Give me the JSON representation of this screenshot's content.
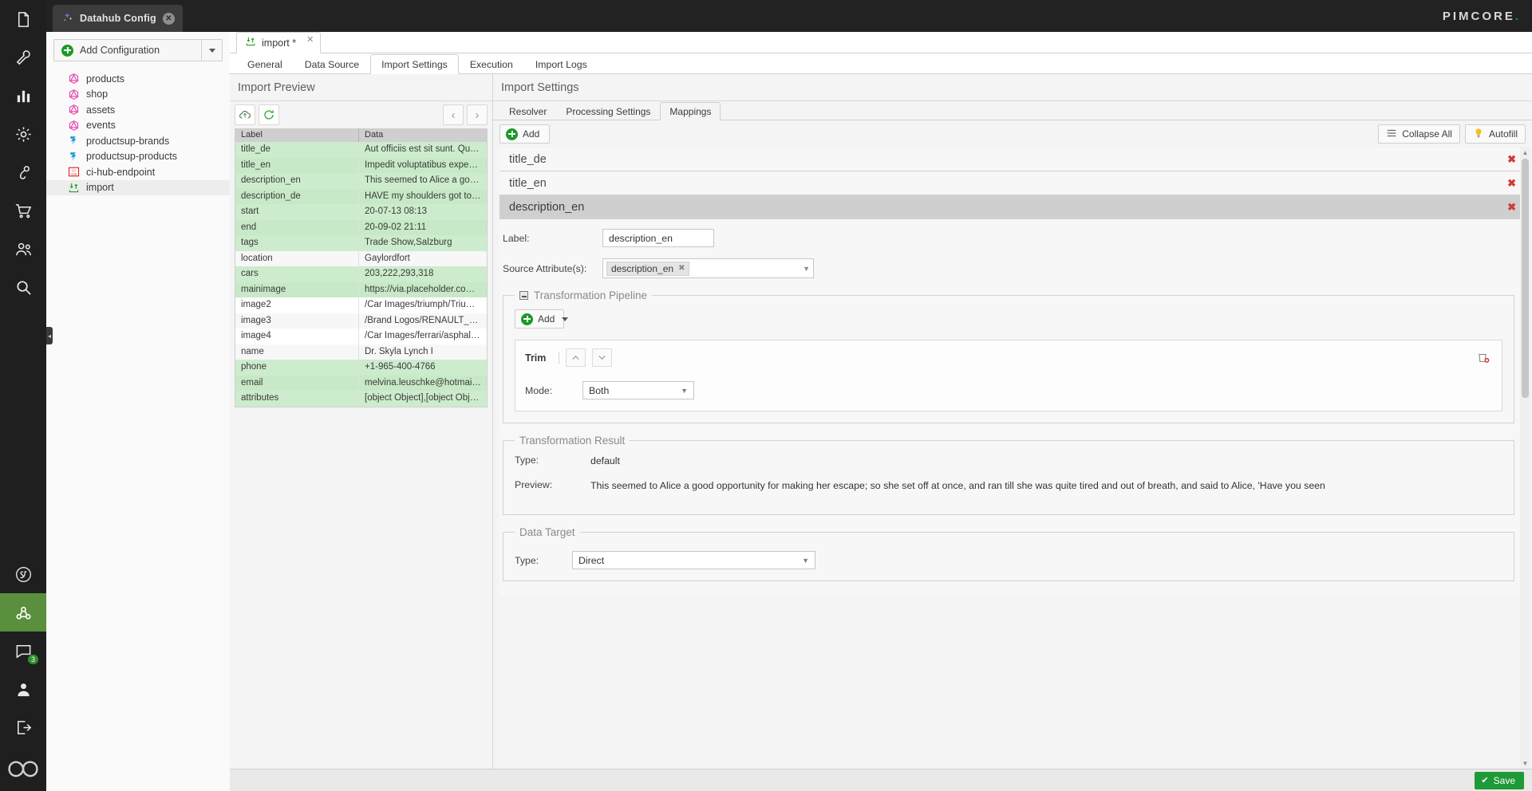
{
  "rail": {
    "items": [
      {
        "name": "documents-icon",
        "label": "Documents"
      },
      {
        "name": "tools-icon",
        "label": "Tools"
      },
      {
        "name": "reports-icon",
        "label": "Reports"
      },
      {
        "name": "settings-gear-icon",
        "label": "Settings"
      },
      {
        "name": "marketing-icon",
        "label": "Marketing"
      },
      {
        "name": "ecommerce-cart-icon",
        "label": "E-Commerce"
      },
      {
        "name": "customers-icon",
        "label": "Customers"
      },
      {
        "name": "search-icon",
        "label": "Search"
      }
    ],
    "lower_items": [
      {
        "name": "symfony-icon",
        "label": "Symfony"
      },
      {
        "name": "datahub-icon",
        "label": "Datahub",
        "active": true
      },
      {
        "name": "comments-icon",
        "label": "Comments",
        "badge": "3"
      },
      {
        "name": "user-account-icon",
        "label": "Account"
      },
      {
        "name": "logout-icon",
        "label": "Logout"
      },
      {
        "name": "pimcore-loop-logo",
        "label": "Pimcore"
      }
    ]
  },
  "sidepanel": {
    "tab_title": "Datahub Config",
    "tab_close": "✕",
    "add_configuration_label": "Add Configuration",
    "tree": [
      {
        "label": "products",
        "icon": "graphql-icon"
      },
      {
        "label": "shop",
        "icon": "graphql-icon"
      },
      {
        "label": "assets",
        "icon": "graphql-icon"
      },
      {
        "label": "events",
        "icon": "graphql-icon"
      },
      {
        "label": "productsup-brands",
        "icon": "productsup-icon"
      },
      {
        "label": "productsup-products",
        "icon": "productsup-icon"
      },
      {
        "label": "ci-hub-endpoint",
        "icon": "cihub-icon"
      },
      {
        "label": "import",
        "icon": "import-icon",
        "selected": true
      }
    ]
  },
  "brand": {
    "name_left": "PIMCORE",
    "name_dot": "."
  },
  "document_tab": {
    "label": "import *",
    "close": "✕",
    "icon": "import-icon"
  },
  "sub_tabs": [
    {
      "label": "General",
      "active": false
    },
    {
      "label": "Data Source",
      "active": false
    },
    {
      "label": "Import Settings",
      "active": true
    },
    {
      "label": "Execution",
      "active": false
    },
    {
      "label": "Import Logs",
      "active": false
    }
  ],
  "import_preview": {
    "title": "Import Preview",
    "upload_icon": "cloud-upload-icon",
    "refresh_icon": "refresh-icon",
    "prev_label": "‹",
    "next_label": "›",
    "columns": [
      "Label",
      "Data"
    ],
    "rows": [
      {
        "label": "title_de",
        "data": "Aut officiis est sit sunt. Qui do...",
        "highlight": true
      },
      {
        "label": "title_en",
        "data": "Impedit voluptatibus expedita...",
        "highlight": true
      },
      {
        "label": "description_en",
        "data": "This seemed to Alice a good o...",
        "highlight": true
      },
      {
        "label": "description_de",
        "data": "HAVE my shoulders got to? An...",
        "highlight": true
      },
      {
        "label": "start",
        "data": "20-07-13 08:13",
        "highlight": true
      },
      {
        "label": "end",
        "data": "20-09-02 21:11",
        "highlight": true
      },
      {
        "label": "tags",
        "data": "Trade Show,Salzburg",
        "highlight": true
      },
      {
        "label": "location",
        "data": "Gaylordfort",
        "highlight": false
      },
      {
        "label": "cars",
        "data": "203,222,293,318",
        "highlight": true
      },
      {
        "label": "mainimage",
        "data": "https://via.placeholder.com/4...",
        "highlight": true
      },
      {
        "label": "image2",
        "data": "/Car Images/triumph/Triump...",
        "highlight": false
      },
      {
        "label": "image3",
        "data": "/Brand Logos/RENAULT_LOG...",
        "highlight": false
      },
      {
        "label": "image4",
        "data": "/Car Images/ferrari/asphalt-a...",
        "highlight": false
      },
      {
        "label": "name",
        "data": "Dr. Skyla Lynch I",
        "highlight": false
      },
      {
        "label": "phone",
        "data": "+1-965-400-4766",
        "highlight": true
      },
      {
        "label": "email",
        "data": "melvina.leuschke@hotmail.com",
        "highlight": true
      },
      {
        "label": "attributes",
        "data": "[object Object],[object Object]",
        "highlight": true
      }
    ]
  },
  "import_settings": {
    "title": "Import Settings",
    "tabs": [
      {
        "label": "Resolver",
        "active": false
      },
      {
        "label": "Processing Settings",
        "active": false
      },
      {
        "label": "Mappings",
        "active": true
      }
    ],
    "toolbar": {
      "add_label": "Add",
      "collapse_all_label": "Collapse All",
      "collapse_icon": "list-lines-icon",
      "autofill_label": "Autofill",
      "autofill_icon": "lightbulb-icon"
    },
    "mappings": [
      {
        "name": "title_de",
        "open": false,
        "remove": "✖"
      },
      {
        "name": "title_en",
        "open": false,
        "remove": "✖"
      },
      {
        "name": "description_en",
        "open": true,
        "remove": "✖"
      }
    ],
    "detail": {
      "label_field_label": "Label:",
      "label_field_value": "description_en",
      "source_attributes_label": "Source Attribute(s):",
      "source_attribute_chip": "description_en",
      "source_attribute_chip_remove": "✖",
      "transformation_pipeline": {
        "legend": "Transformation Pipeline",
        "add_label": "Add",
        "step": {
          "title": "Trim",
          "up_icon": "chevron-up-icon",
          "down_icon": "chevron-down-icon",
          "delete_icon": "delete-step-icon",
          "mode_label": "Mode:",
          "mode_value": "Both"
        }
      },
      "transformation_result": {
        "legend": "Transformation Result",
        "type_label": "Type:",
        "type_value": "default",
        "preview_label": "Preview:",
        "preview_value": "This seemed to Alice a good opportunity for making her escape; so she set off at once, and ran till she was quite tired and out of breath, and said to Alice, 'Have you seen"
      },
      "data_target": {
        "legend": "Data Target",
        "type_label": "Type:",
        "type_value": "Direct"
      }
    }
  },
  "footer": {
    "save_label": "Save",
    "save_check": "✔"
  },
  "colors": {
    "accent_green": "#1f9a38",
    "highlight_row": "#cdeccd",
    "remove_red": "#d43a3a",
    "rail_active": "#5a8f3d"
  }
}
